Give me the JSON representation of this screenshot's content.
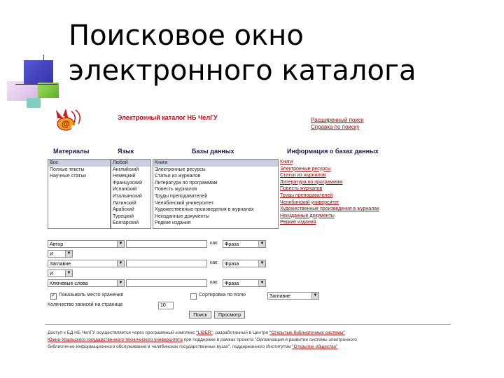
{
  "slide": {
    "title_line1": "Поисковое окно",
    "title_line2": "электронного каталога"
  },
  "catalog": {
    "header_title": "Электронный каталог НБ ЧелГУ",
    "top_links": [
      "Расширенный поиск",
      "Справка по поиску"
    ],
    "columns": {
      "materials": "Материалы",
      "language": "Язык",
      "databases": "Базы данных",
      "db_info": "Информация о базах данных"
    },
    "materials_items": [
      "Все",
      "Полные тексты",
      "Научные статьи"
    ],
    "language_items": [
      "Любой",
      "Английский",
      "Немецкий",
      "Французский",
      "Испанский",
      "Итальянский",
      "Латинский",
      "Арабский",
      "Турецкий",
      "Болгарский"
    ],
    "database_items": [
      "Книги",
      "Электронные ресурсы",
      "Статьи из журналов",
      "Литература по программам",
      "Повесть журналов",
      "Труды преподавателей",
      "Челябинский университет",
      "Художественные произведения в журналах",
      "Неизданные документы",
      "Редкие издания"
    ],
    "info_links": [
      "Книги",
      "Электронные ресурсы",
      "Статьи из журналов",
      "Литература по программам",
      "Повесть журналов",
      "Труды преподавателей",
      "Челябинский университет",
      "Художественные произведения в журналах",
      "Неизданные документы",
      "Редкие издания"
    ],
    "search_rows": [
      {
        "field": "Автор",
        "how_label": "как:",
        "mode": "Фраза"
      },
      {
        "field": "Заглавие",
        "how_label": "как:",
        "mode": "Фраза"
      },
      {
        "field": "Ключевые слова",
        "how_label": "как:",
        "mode": "Фраза"
      }
    ],
    "operators": [
      "И",
      "И"
    ],
    "checkbox_exact": "Показывать место хранения",
    "checkbox_sort": "Сортировка по полю",
    "sort_value": "Заглавие",
    "count_label": "Количество записей на странице",
    "count_value": "10",
    "search_button": "Поиск",
    "view_button": "Просмотр",
    "footer_line1_a": "Доступ к БД НБ ЧелГУ осуществляется через программный комплекс ",
    "footer_line1_link1": "\"LIBER\"",
    "footer_line1_b": ", разработанный в Центре ",
    "footer_line1_link2": "\"Открытые библиотечные системы\"",
    "footer_line2_link": "Южно-Уральского государственного технического университета",
    "footer_line2_b": " при поддержке в рамках проекта \"Организация и развитие системы электронного",
    "footer_line3_a": "библиотечно-информационного обслуживания в челябинских государственных вузах\", поддержанного Институтом ",
    "footer_line3_link": "\"Открытое общество\""
  }
}
